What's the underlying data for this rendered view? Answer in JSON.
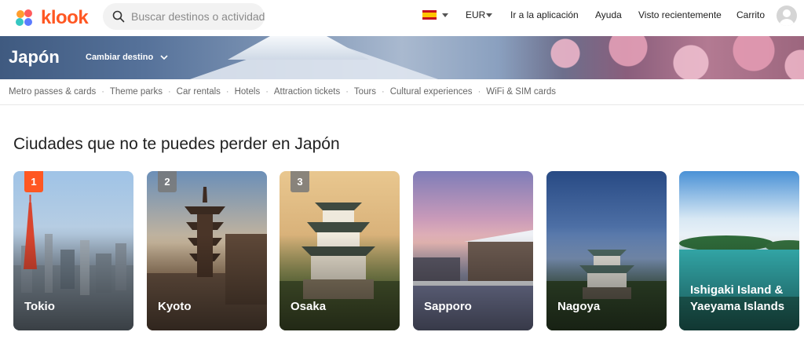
{
  "header": {
    "logo_text": "klook",
    "search_placeholder": "Buscar destinos o actividades",
    "currency": "EUR",
    "nav": {
      "app": "Ir a la aplicación",
      "help": "Ayuda",
      "recent": "Visto recientemente",
      "cart": "Carrito"
    },
    "accent_color": "#ff5722"
  },
  "banner": {
    "title": "Japón",
    "change_destination": "Cambiar destino"
  },
  "categories": [
    "Metro passes & cards",
    "Theme parks",
    "Car rentals",
    "Hotels",
    "Attraction tickets",
    "Tours",
    "Cultural experiences",
    "WiFi & SIM cards"
  ],
  "section": {
    "title": "Ciudades que no te puedes perder en Japón"
  },
  "cities": [
    {
      "rank": "1",
      "name": "Tokio"
    },
    {
      "rank": "2",
      "name": "Kyoto"
    },
    {
      "rank": "3",
      "name": "Osaka"
    },
    {
      "rank": "",
      "name": "Sapporo"
    },
    {
      "rank": "",
      "name": "Nagoya"
    },
    {
      "rank": "",
      "name": "Ishigaki Island & Yaeyama Islands"
    }
  ]
}
